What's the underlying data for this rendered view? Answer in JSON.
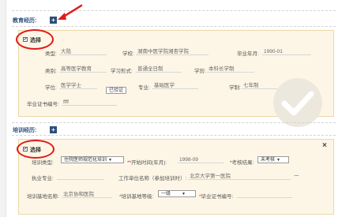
{
  "education": {
    "section_title": "教育经历:",
    "add_icon": "plus-icon",
    "select_label": "选择",
    "checkbox_checked": "✔",
    "rows": {
      "type_label": "类型:",
      "type_value": "大陆",
      "school_label": "学校:",
      "school_value": "湖南中医学院湘杏学院",
      "grad_year_label": "毕业年月:",
      "grad_year_value": "1990-01",
      "category_label": "类别:",
      "category_value": "高等医学教育",
      "study_form_label": "学习形式:",
      "study_form_value": "普通全日制",
      "education_label": "学历:",
      "education_value": "本科长学制",
      "degree_label": "学位:",
      "degree_value": "医学学士",
      "verify_button": "已验证",
      "major_label": "专业:",
      "major_value": "基础医学",
      "schooling_label": "学制:",
      "schooling_value": "七年制",
      "cert_no_label": "毕业证书编号:",
      "cert_no_value": "ffff"
    },
    "watermark_icon": "checkmark-icon"
  },
  "training": {
    "section_title": "培训经历:",
    "add_icon": "plus-icon",
    "select_label": "选择",
    "checkbox_checked": "✔",
    "close_icon": "×",
    "rows": {
      "training_type_label": "培训类型:",
      "training_type_value": "住院医师规范化培训",
      "start_time_label": "*开始时间(年月):",
      "start_time_value": "1998-09",
      "assess_label": "*考核结果:",
      "assess_value": "未考核",
      "major_label": "执业专业:",
      "major_value": "",
      "workplace_label": "工作单位名称（参加培训时）:",
      "workplace_value": "北京大学第一医院",
      "ellipsis": "…",
      "base_name_label": "培训基地名称:",
      "base_name_value": "北京协和医院",
      "base_level_label": "*培训基地等级:",
      "base_level_value": "一级",
      "cert_no_label": "毕业证书编号:",
      "cert_no_value": ""
    }
  },
  "annotations": {
    "arrow_color": "#e01b1b",
    "oval_color": "#e01b1b"
  }
}
